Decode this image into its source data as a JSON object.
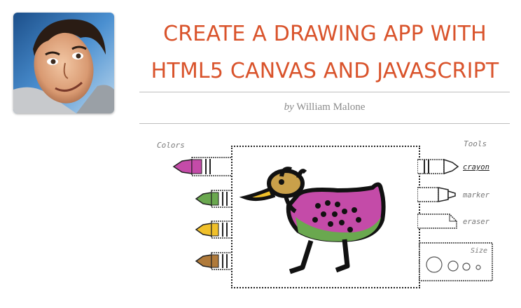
{
  "header": {
    "title_line1": "CREATE A DRAWING APP WITH",
    "title_line2": "HTML5 CANVAS AND JAVASCRIPT",
    "byline_prefix": "by",
    "author": "William Malone"
  },
  "app": {
    "colors_label": "Colors",
    "tools_label": "Tools",
    "size_label": "Size",
    "colors": [
      {
        "name": "purple",
        "hex": "#c44ba8"
      },
      {
        "name": "green",
        "hex": "#6aa84f"
      },
      {
        "name": "yellow",
        "hex": "#f0c02a"
      },
      {
        "name": "brown",
        "hex": "#b07a3a"
      }
    ],
    "selected_color": "purple",
    "tools": [
      {
        "label": "crayon",
        "active": true
      },
      {
        "label": "marker",
        "active": false
      },
      {
        "label": "eraser",
        "active": false
      }
    ]
  },
  "theme": {
    "accent": "#d9532b"
  }
}
